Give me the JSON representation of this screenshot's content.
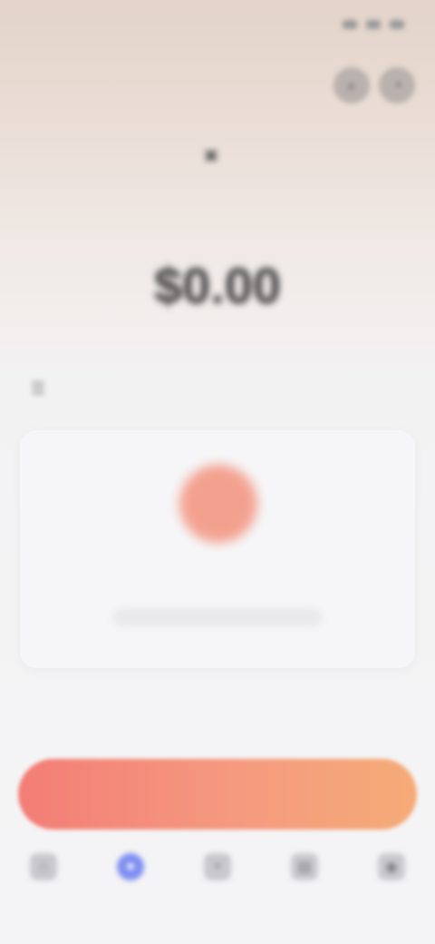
{
  "status_bar": {
    "time": "",
    "icons": [
      "signal-icon",
      "wifi-icon",
      "battery-icon"
    ]
  },
  "header": {
    "app_name": "",
    "actions": [
      {
        "icon": "search-icon",
        "glyph": "⌕"
      },
      {
        "icon": "bell-icon",
        "glyph": "◔"
      }
    ]
  },
  "account": {
    "icon": "wallet-icon",
    "label": ""
  },
  "balance": {
    "caption": "",
    "value": "$0.00"
  },
  "section": {
    "icon": "list-icon",
    "right_text": ""
  },
  "empty_card": {
    "illustration": "empty-state-illustration",
    "title": "",
    "subtitle": ""
  },
  "cta": {
    "label": ""
  },
  "tabs": [
    {
      "icon": "home-icon",
      "glyph": "⌂",
      "label": "",
      "active": false
    },
    {
      "icon": "wallet-icon",
      "glyph": "●",
      "label": "",
      "active": true
    },
    {
      "icon": "plus-icon",
      "glyph": "+",
      "label": "",
      "active": false
    },
    {
      "icon": "chart-icon",
      "glyph": "▤",
      "label": "",
      "active": false
    },
    {
      "icon": "profile-icon",
      "glyph": "◉",
      "label": "",
      "active": false
    }
  ],
  "colors": {
    "accent": "#7f8ff0",
    "cta_start": "#f37d76",
    "cta_end": "#f5ab77",
    "illustration": "#f3a18f"
  }
}
